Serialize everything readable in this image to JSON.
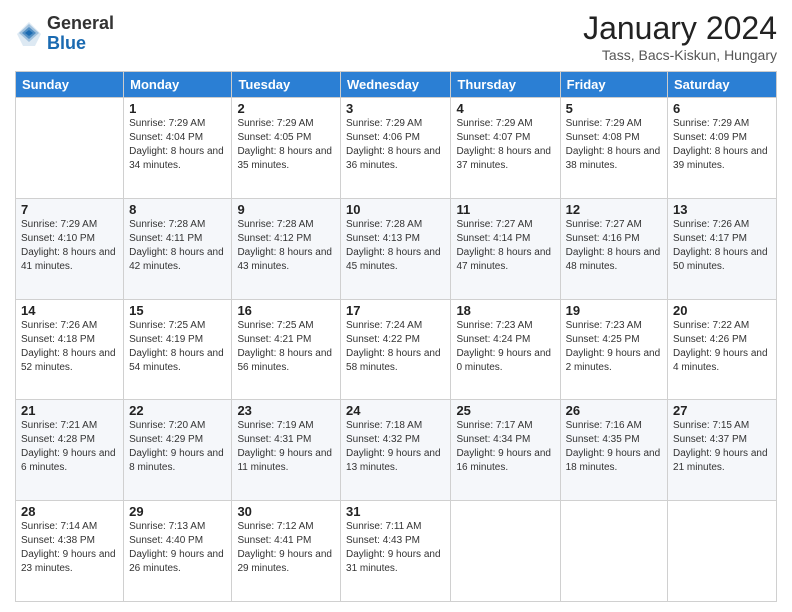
{
  "logo": {
    "general": "General",
    "blue": "Blue"
  },
  "header": {
    "month": "January 2024",
    "location": "Tass, Bacs-Kiskun, Hungary"
  },
  "weekdays": [
    "Sunday",
    "Monday",
    "Tuesday",
    "Wednesday",
    "Thursday",
    "Friday",
    "Saturday"
  ],
  "weeks": [
    [
      {
        "day": "",
        "sunrise": "",
        "sunset": "",
        "daylight": ""
      },
      {
        "day": "1",
        "sunrise": "Sunrise: 7:29 AM",
        "sunset": "Sunset: 4:04 PM",
        "daylight": "Daylight: 8 hours and 34 minutes."
      },
      {
        "day": "2",
        "sunrise": "Sunrise: 7:29 AM",
        "sunset": "Sunset: 4:05 PM",
        "daylight": "Daylight: 8 hours and 35 minutes."
      },
      {
        "day": "3",
        "sunrise": "Sunrise: 7:29 AM",
        "sunset": "Sunset: 4:06 PM",
        "daylight": "Daylight: 8 hours and 36 minutes."
      },
      {
        "day": "4",
        "sunrise": "Sunrise: 7:29 AM",
        "sunset": "Sunset: 4:07 PM",
        "daylight": "Daylight: 8 hours and 37 minutes."
      },
      {
        "day": "5",
        "sunrise": "Sunrise: 7:29 AM",
        "sunset": "Sunset: 4:08 PM",
        "daylight": "Daylight: 8 hours and 38 minutes."
      },
      {
        "day": "6",
        "sunrise": "Sunrise: 7:29 AM",
        "sunset": "Sunset: 4:09 PM",
        "daylight": "Daylight: 8 hours and 39 minutes."
      }
    ],
    [
      {
        "day": "7",
        "sunrise": "Sunrise: 7:29 AM",
        "sunset": "Sunset: 4:10 PM",
        "daylight": "Daylight: 8 hours and 41 minutes."
      },
      {
        "day": "8",
        "sunrise": "Sunrise: 7:28 AM",
        "sunset": "Sunset: 4:11 PM",
        "daylight": "Daylight: 8 hours and 42 minutes."
      },
      {
        "day": "9",
        "sunrise": "Sunrise: 7:28 AM",
        "sunset": "Sunset: 4:12 PM",
        "daylight": "Daylight: 8 hours and 43 minutes."
      },
      {
        "day": "10",
        "sunrise": "Sunrise: 7:28 AM",
        "sunset": "Sunset: 4:13 PM",
        "daylight": "Daylight: 8 hours and 45 minutes."
      },
      {
        "day": "11",
        "sunrise": "Sunrise: 7:27 AM",
        "sunset": "Sunset: 4:14 PM",
        "daylight": "Daylight: 8 hours and 47 minutes."
      },
      {
        "day": "12",
        "sunrise": "Sunrise: 7:27 AM",
        "sunset": "Sunset: 4:16 PM",
        "daylight": "Daylight: 8 hours and 48 minutes."
      },
      {
        "day": "13",
        "sunrise": "Sunrise: 7:26 AM",
        "sunset": "Sunset: 4:17 PM",
        "daylight": "Daylight: 8 hours and 50 minutes."
      }
    ],
    [
      {
        "day": "14",
        "sunrise": "Sunrise: 7:26 AM",
        "sunset": "Sunset: 4:18 PM",
        "daylight": "Daylight: 8 hours and 52 minutes."
      },
      {
        "day": "15",
        "sunrise": "Sunrise: 7:25 AM",
        "sunset": "Sunset: 4:19 PM",
        "daylight": "Daylight: 8 hours and 54 minutes."
      },
      {
        "day": "16",
        "sunrise": "Sunrise: 7:25 AM",
        "sunset": "Sunset: 4:21 PM",
        "daylight": "Daylight: 8 hours and 56 minutes."
      },
      {
        "day": "17",
        "sunrise": "Sunrise: 7:24 AM",
        "sunset": "Sunset: 4:22 PM",
        "daylight": "Daylight: 8 hours and 58 minutes."
      },
      {
        "day": "18",
        "sunrise": "Sunrise: 7:23 AM",
        "sunset": "Sunset: 4:24 PM",
        "daylight": "Daylight: 9 hours and 0 minutes."
      },
      {
        "day": "19",
        "sunrise": "Sunrise: 7:23 AM",
        "sunset": "Sunset: 4:25 PM",
        "daylight": "Daylight: 9 hours and 2 minutes."
      },
      {
        "day": "20",
        "sunrise": "Sunrise: 7:22 AM",
        "sunset": "Sunset: 4:26 PM",
        "daylight": "Daylight: 9 hours and 4 minutes."
      }
    ],
    [
      {
        "day": "21",
        "sunrise": "Sunrise: 7:21 AM",
        "sunset": "Sunset: 4:28 PM",
        "daylight": "Daylight: 9 hours and 6 minutes."
      },
      {
        "day": "22",
        "sunrise": "Sunrise: 7:20 AM",
        "sunset": "Sunset: 4:29 PM",
        "daylight": "Daylight: 9 hours and 8 minutes."
      },
      {
        "day": "23",
        "sunrise": "Sunrise: 7:19 AM",
        "sunset": "Sunset: 4:31 PM",
        "daylight": "Daylight: 9 hours and 11 minutes."
      },
      {
        "day": "24",
        "sunrise": "Sunrise: 7:18 AM",
        "sunset": "Sunset: 4:32 PM",
        "daylight": "Daylight: 9 hours and 13 minutes."
      },
      {
        "day": "25",
        "sunrise": "Sunrise: 7:17 AM",
        "sunset": "Sunset: 4:34 PM",
        "daylight": "Daylight: 9 hours and 16 minutes."
      },
      {
        "day": "26",
        "sunrise": "Sunrise: 7:16 AM",
        "sunset": "Sunset: 4:35 PM",
        "daylight": "Daylight: 9 hours and 18 minutes."
      },
      {
        "day": "27",
        "sunrise": "Sunrise: 7:15 AM",
        "sunset": "Sunset: 4:37 PM",
        "daylight": "Daylight: 9 hours and 21 minutes."
      }
    ],
    [
      {
        "day": "28",
        "sunrise": "Sunrise: 7:14 AM",
        "sunset": "Sunset: 4:38 PM",
        "daylight": "Daylight: 9 hours and 23 minutes."
      },
      {
        "day": "29",
        "sunrise": "Sunrise: 7:13 AM",
        "sunset": "Sunset: 4:40 PM",
        "daylight": "Daylight: 9 hours and 26 minutes."
      },
      {
        "day": "30",
        "sunrise": "Sunrise: 7:12 AM",
        "sunset": "Sunset: 4:41 PM",
        "daylight": "Daylight: 9 hours and 29 minutes."
      },
      {
        "day": "31",
        "sunrise": "Sunrise: 7:11 AM",
        "sunset": "Sunset: 4:43 PM",
        "daylight": "Daylight: 9 hours and 31 minutes."
      },
      {
        "day": "",
        "sunrise": "",
        "sunset": "",
        "daylight": ""
      },
      {
        "day": "",
        "sunrise": "",
        "sunset": "",
        "daylight": ""
      },
      {
        "day": "",
        "sunrise": "",
        "sunset": "",
        "daylight": ""
      }
    ]
  ]
}
